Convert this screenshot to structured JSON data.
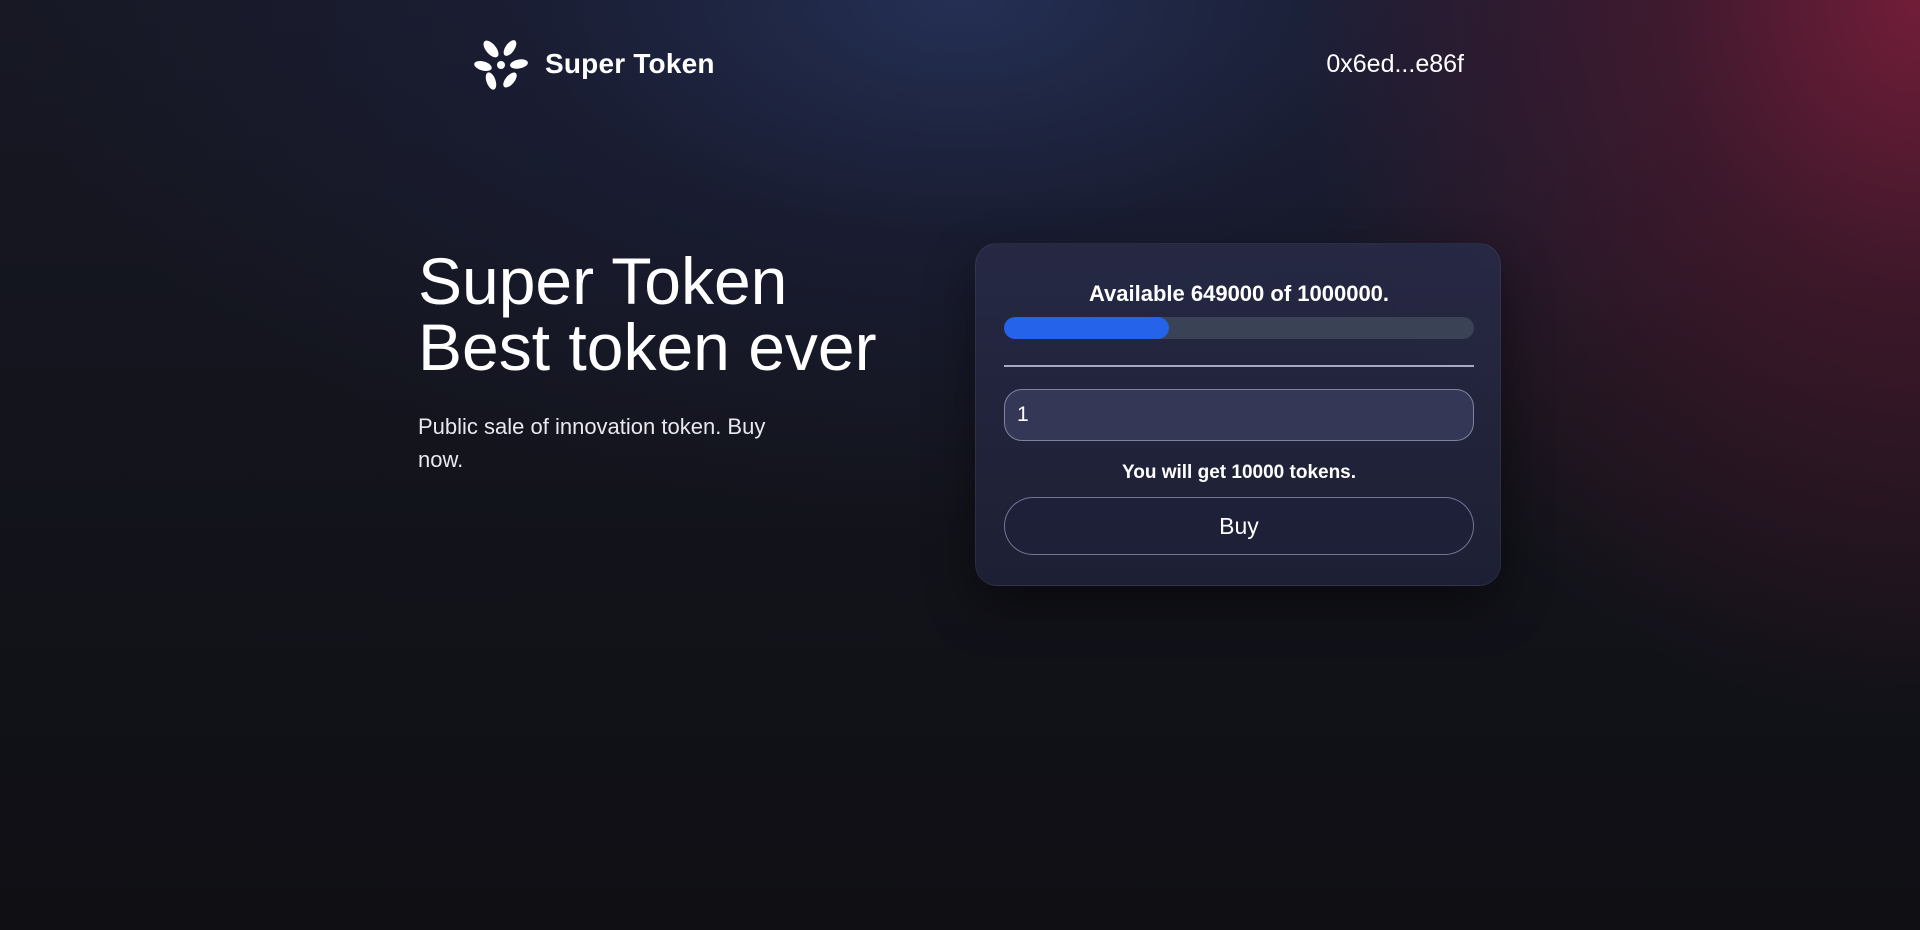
{
  "header": {
    "brand_name": "Super Token",
    "brand_icon": "leaf-cluster-logo-icon",
    "wallet_address": "0x6ed...e86f"
  },
  "hero": {
    "title_line1": "Super Token",
    "title_line2": "Best token ever",
    "subtitle": "Public sale of innovation token. Buy now."
  },
  "sale_card": {
    "available_text": "Available 649000 of 1000000.",
    "available": 649000,
    "total": 1000000,
    "progress_fill_fraction": 0.351,
    "amount_input_value": "1",
    "you_will_get_text": "You will get 10000 tokens.",
    "buy_label": "Buy"
  },
  "colors": {
    "progress_fill": "#2563eb",
    "progress_track": "#3a4356",
    "background": "#101015",
    "accent_glow": "#82203c"
  }
}
